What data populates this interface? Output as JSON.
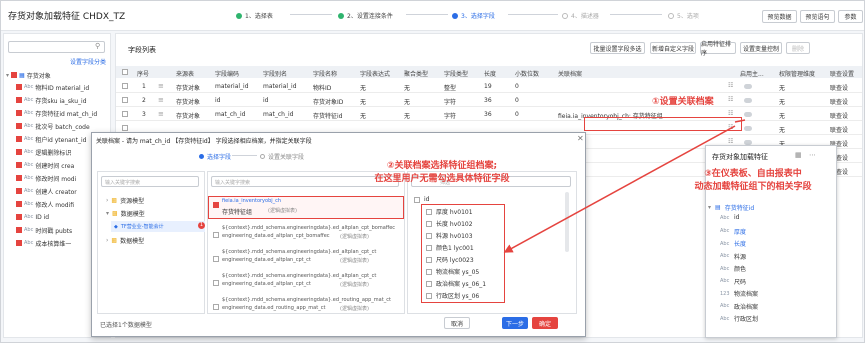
{
  "window": {
    "title": "存货对象加载特征 CHDX_TZ"
  },
  "steps": [
    {
      "label": "1、选择表",
      "state": "done"
    },
    {
      "label": "2、设置连接条件",
      "state": "done"
    },
    {
      "label": "3、选择字段",
      "state": "current"
    },
    {
      "label": "4、描述器",
      "state": "todo"
    },
    {
      "label": "5、选项",
      "state": "todo"
    }
  ],
  "top_buttons": {
    "preview": "预览数据",
    "preview_sql": "预览语句",
    "params": "参数"
  },
  "left_panel": {
    "search_placeholder": "",
    "tab": "设置字段分类",
    "root": "存货对象",
    "items": [
      "物料ID material_id",
      "存货sku ia_sku_id",
      "存货特征id mat_ch_id",
      "批次号 batch_code",
      "租户id ytenant_id",
      "逻辑删除标识",
      "创建时间 crea",
      "修改时间 modi",
      "创建人 creator",
      "修改人 modifi",
      "ID id",
      "时间戳 pubts",
      "成本核算维一"
    ]
  },
  "main": {
    "section_title": "字段列表",
    "toolbar": {
      "batch": "批量设置字段多选",
      "add_custom": "新增自定义字段",
      "enable_sort": "启用特征排序",
      "set_var": "设置变量控制",
      "delete": "删除"
    },
    "columns": [
      "序号",
      "来源表",
      "字段编码",
      "字段别名",
      "字段名称",
      "字段表达式",
      "聚合类型",
      "字段类型",
      "长度",
      "小数位数",
      "关联档案",
      "启用主...",
      "权限管理维度",
      "联查设置"
    ],
    "rows": [
      {
        "no": "1",
        "src": "存货对象",
        "code": "material_id",
        "alias": "material_id",
        "name": "物料ID",
        "expr": "无",
        "agg": "无",
        "type": "整型",
        "len": "19",
        "dec": "0",
        "ref": "",
        "perm": "无",
        "link": "联查设"
      },
      {
        "no": "2",
        "src": "存货对象",
        "code": "id",
        "alias": "id",
        "name": "存货对象ID",
        "expr": "无",
        "agg": "无",
        "type": "字符",
        "len": "36",
        "dec": "0",
        "ref": "",
        "perm": "无",
        "link": "联查设"
      },
      {
        "no": "3",
        "src": "存货对象",
        "code": "mat_ch_id",
        "alias": "mat_ch_id",
        "name": "存货特征id",
        "expr": "无",
        "agg": "无",
        "type": "字符",
        "len": "36",
        "dec": "0",
        "ref": "fieia.ia_inventoryobj_ch:  存货特征组",
        "perm": "无",
        "link": "联查设"
      },
      {
        "no": "",
        "src": "",
        "code": "",
        "alias": "",
        "name": "",
        "expr": "",
        "agg": "",
        "type": "",
        "len": "",
        "dec": "",
        "ref": "",
        "perm": "无",
        "link": "联查设"
      },
      {
        "no": "",
        "src": "",
        "code": "",
        "alias": "",
        "name": "",
        "expr": "",
        "agg": "",
        "type": "",
        "len": "",
        "dec": "",
        "ref": "",
        "perm": "无",
        "link": "联查设"
      },
      {
        "no": "",
        "src": "",
        "code": "",
        "alias": "",
        "name": "",
        "expr": "",
        "agg": "",
        "type": "",
        "len": "",
        "dec": "",
        "ref": "",
        "perm": "无",
        "link": "联查设"
      },
      {
        "no": "",
        "src": "",
        "code": "",
        "alias": "",
        "name": "",
        "expr": "",
        "agg": "",
        "type": "",
        "len": "",
        "dec": "",
        "ref": "",
        "perm": "无",
        "link": "联查设"
      }
    ]
  },
  "dialog": {
    "title": "关联档案 - 请为 mat_ch_id 【存货特征id】 字段选择相应档案，并指定关联字段",
    "tab_select": "选择字段",
    "tab_set": "设置关联字段",
    "kw_placeholder": "输入关键字搜索",
    "tree": {
      "resource": "资源模型",
      "data": "数据模型",
      "model": "TF营业业-智能会计",
      "other": "数据模型"
    },
    "selected_item": {
      "code": "fieia.ia_inventoryobj_ch",
      "name": "存货特征组",
      "tag": "(逻辑虚拟表)"
    },
    "list": [
      {
        "code": "${context}.mdd_schema.engineeringdata}.ed_altplan_cpt_bomaffec",
        "code2": "engineering_data.ed_altplan_cpt_bomaffec",
        "tag": "(逻辑虚拟表)"
      },
      {
        "code": "${context}.mdd_schema.engineeringdata}.ed_altplan_cpt_ct",
        "code2": "engineering_data.ed_altplan_cpt_ct",
        "tag": "(逻辑虚拟表)"
      },
      {
        "code": "${context}.mdd_schema.engineeringdata}.ed_altplan_cpt_ct",
        "code2": "engineering_data.ed_altplan_cpt_ct",
        "tag": "(逻辑虚拟表)"
      },
      {
        "code": "${context}.mdd_schema.engineeringdata}.ed_routing_app_mat_ct",
        "code2": "engineering_data.ed_routing_app_mat_ct",
        "tag": "(逻辑虚拟表)"
      }
    ],
    "fields_search": "筛选",
    "field_id": "id",
    "fields": [
      "厚度 hv0101",
      "长度 hv0102",
      "料源 hv0103",
      "颜色1 lyc001",
      "尺码 lyc0023",
      "物流档案 ys_05",
      "政治档案 ys_06_1",
      "行政区划 ys_06"
    ],
    "footer": "已选择1个数据模型",
    "cancel": "取消",
    "next": "下一步",
    "ok": "确定"
  },
  "annotations": {
    "a1": "①设置关联档案",
    "a2_line1": "②关联档案选择特征组档案;",
    "a2_line2": "在这里用户无需勾选具体特征字段",
    "a3_line1": "③在仪表板、自由报表中",
    "a3_line2": "动态加载特征组下的相关字段"
  },
  "right_panel": {
    "title": "存货对象加载特征",
    "group": "存货特征id",
    "fields": [
      {
        "t": "Abc",
        "n": "id"
      },
      {
        "t": "Abc",
        "n": "厚度"
      },
      {
        "t": "Abc",
        "n": "长度"
      },
      {
        "t": "Abc",
        "n": "料源"
      },
      {
        "t": "Abc",
        "n": "颜色"
      },
      {
        "t": "Abc",
        "n": "尺码"
      },
      {
        "t": "123",
        "n": "物流档案"
      },
      {
        "t": "Abc",
        "n": "政治档案"
      },
      {
        "t": "Abc",
        "n": "行政区划"
      }
    ]
  },
  "colors": {
    "accent": "#2b6de6",
    "highlight": "#e5443f",
    "done": "#2fb46e"
  }
}
